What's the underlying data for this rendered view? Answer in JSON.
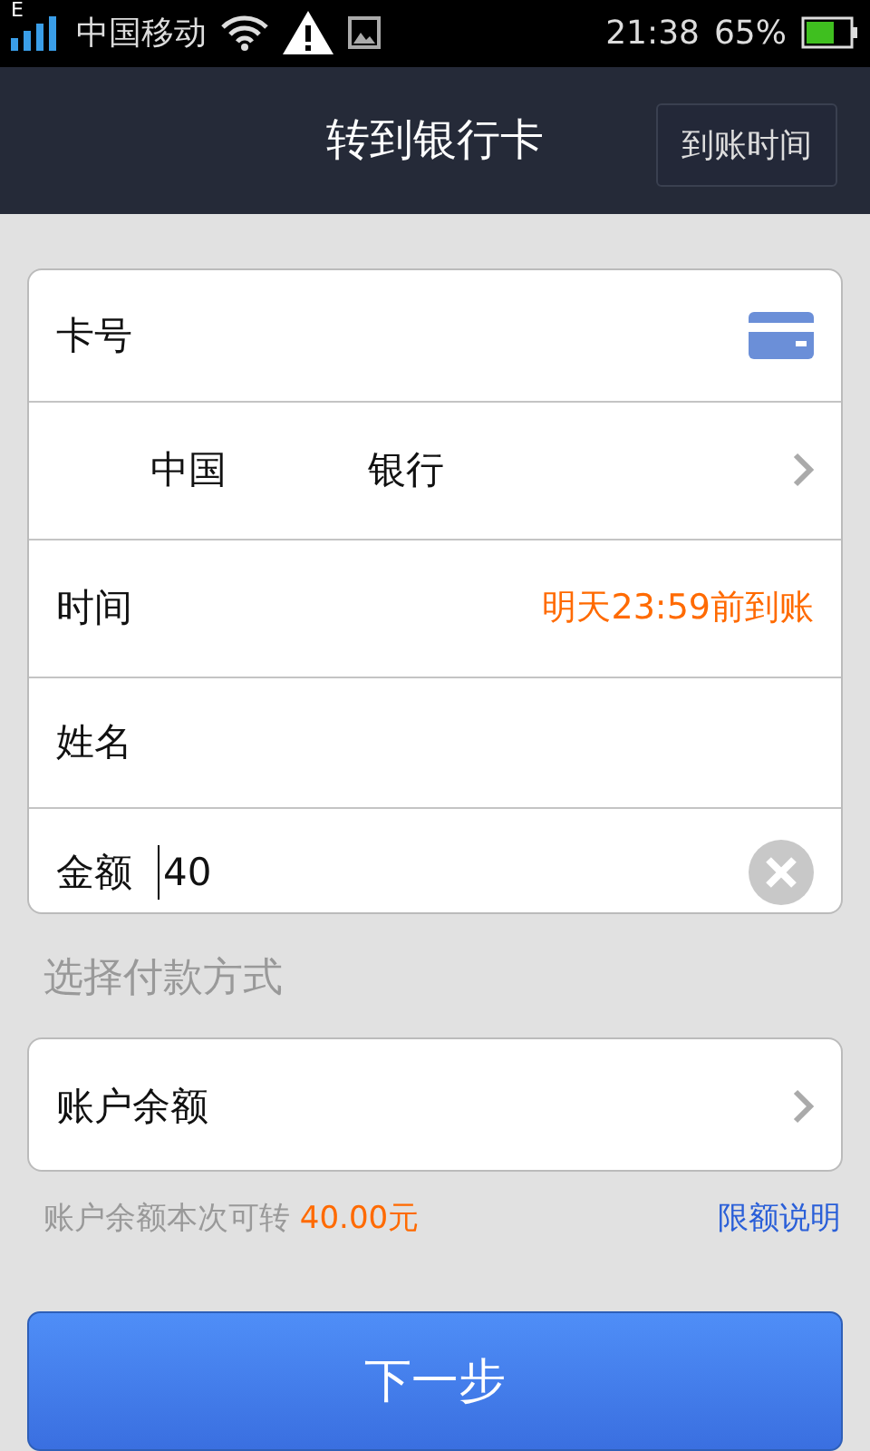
{
  "status_bar": {
    "network": "E",
    "carrier": "中国移动",
    "time": "21:38",
    "battery": "65%"
  },
  "header": {
    "title": "转到银行卡",
    "action": "到账时间"
  },
  "form": [
    {
      "kind": "card",
      "label": "卡号"
    },
    {
      "kind": "bank",
      "name_start": "中国",
      "name_end": "银行"
    },
    {
      "kind": "info",
      "label": "时间",
      "value": "明天23:59前到账"
    },
    {
      "kind": "plain",
      "label": "姓名"
    },
    {
      "kind": "amount",
      "label": "金额",
      "value": "40"
    }
  ],
  "payment_section": {
    "title": "选择付款方式",
    "method": "账户余额"
  },
  "note": {
    "text": "账户余额本次可转",
    "amount": "40.00元",
    "link": "限额说明"
  },
  "submit": "下一步"
}
